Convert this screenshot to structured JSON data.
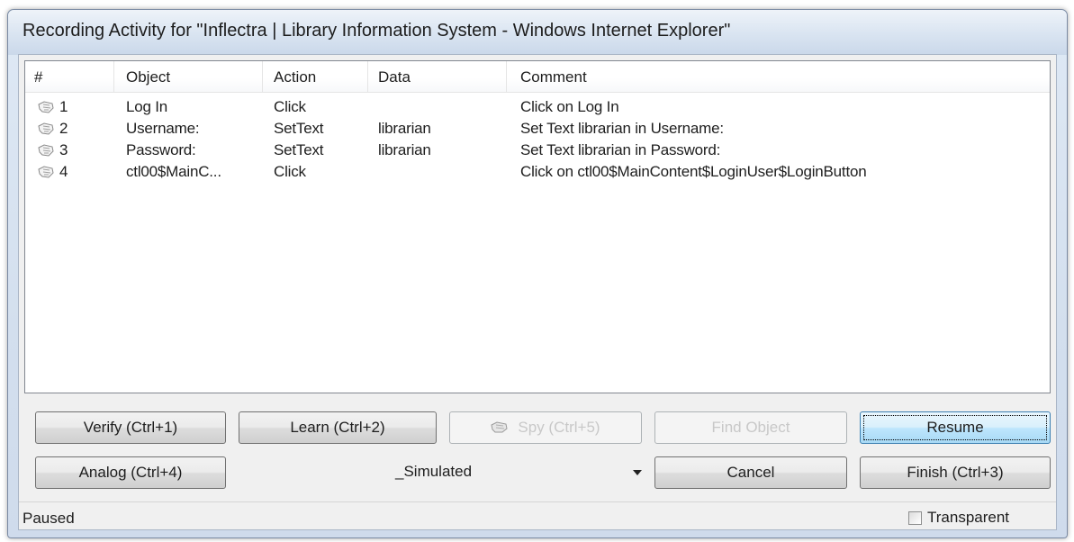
{
  "window": {
    "title": "Recording Activity for \"Inflectra | Library Information System - Windows Internet Explorer\""
  },
  "columns": [
    "#",
    "Object",
    "Action",
    "Data",
    "Comment"
  ],
  "rows": [
    {
      "num": "1",
      "object": "Log In",
      "action": "Click",
      "data": "",
      "comment": "Click on Log In"
    },
    {
      "num": "2",
      "object": "Username:",
      "action": "SetText",
      "data": "librarian",
      "comment": "Set Text librarian in Username:"
    },
    {
      "num": "3",
      "object": "Password:",
      "action": "SetText",
      "data": "librarian",
      "comment": "Set Text librarian in Password:"
    },
    {
      "num": "4",
      "object": "ctl00$MainC...",
      "action": "Click",
      "data": "",
      "comment": "Click on ctl00$MainContent$LoginUser$LoginButton"
    }
  ],
  "buttons": {
    "verify": "Verify (Ctrl+1)",
    "learn": "Learn (Ctrl+2)",
    "spy": "Spy (Ctrl+5)",
    "find_object": "Find Object",
    "resume": "Resume",
    "analog": "Analog (Ctrl+4)",
    "cancel": "Cancel",
    "finish": "Finish (Ctrl+3)"
  },
  "play_mode": {
    "selected": "_Simulated"
  },
  "status": {
    "text": "Paused",
    "transparent_label": "Transparent",
    "transparent_checked": false
  },
  "icons": {
    "row_icon": "hand-pointer-icon",
    "spy_icon": "hand-pointer-icon"
  }
}
